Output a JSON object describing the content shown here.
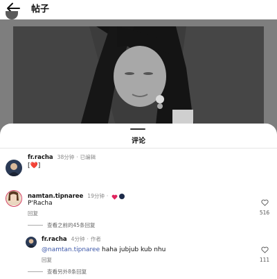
{
  "header": {
    "title": "帖子"
  },
  "sheet": {
    "title": "评论"
  },
  "comments": [
    {
      "username": "fr.racha",
      "time": "38分钟",
      "status": "已编辑",
      "text": "[❤️]"
    },
    {
      "username": "namtan.tipnaree",
      "time": "19分钟",
      "text": "P'Racha",
      "reply_label": "回复",
      "like_count": "516",
      "hidden_replies": "查看之前的45条回复",
      "reply": {
        "username": "fr.racha",
        "time": "4分钟",
        "author_badge": "作者",
        "mention": "@namtan.tipnaree",
        "text": " haha jubjub kub nhu",
        "reply_label": "回复",
        "like_count": "111"
      },
      "more_replies": "查看另外8条回复"
    }
  ],
  "colors": {
    "like_heart": "#e0245e",
    "mention": "#3b56a8",
    "overlay": "#7e7e7e"
  },
  "icons": [
    "back-arrow-icon",
    "heart-outline-icon",
    "red-heart-icon",
    "globe-icon"
  ]
}
